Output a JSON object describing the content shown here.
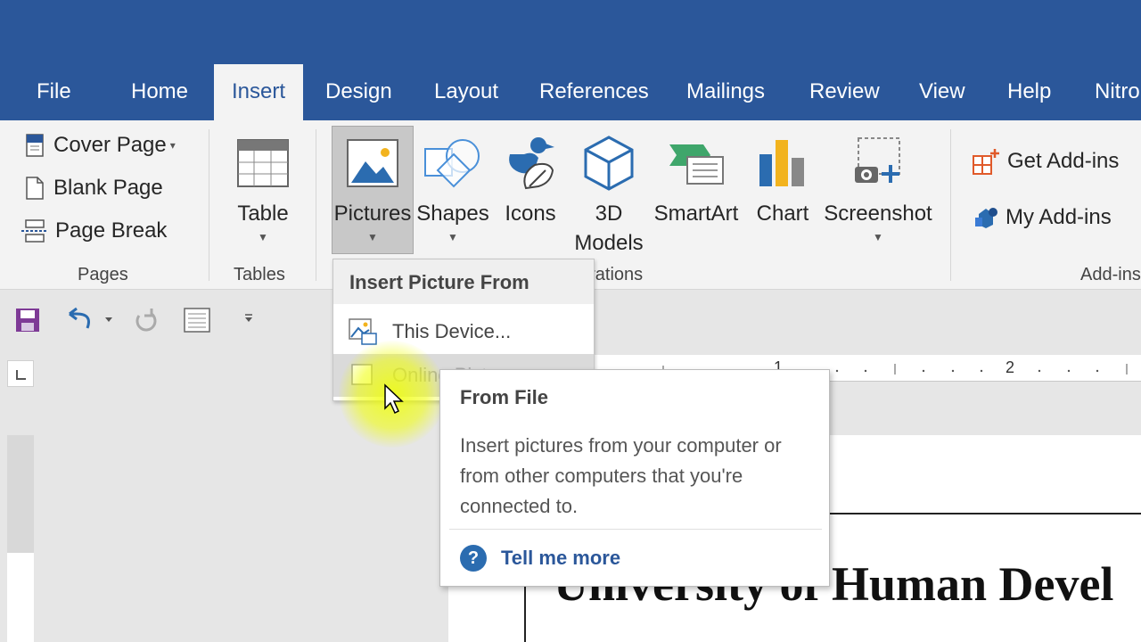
{
  "tabs": [
    "File",
    "Home",
    "Insert",
    "Design",
    "Layout",
    "References",
    "Mailings",
    "Review",
    "View",
    "Help",
    "Nitro"
  ],
  "active_tab": "Insert",
  "pages_group": {
    "label": "Pages",
    "items": [
      "Cover Page",
      "Blank Page",
      "Page Break"
    ]
  },
  "tables_group": {
    "label": "Tables",
    "table": "Table"
  },
  "illustrations_group": {
    "label": "Illustrations",
    "pictures": "Pictures",
    "shapes": "Shapes",
    "icons": "Icons",
    "models_line1": "3D",
    "models_line2": "Models",
    "smartart": "SmartArt",
    "chart": "Chart",
    "screenshot": "Screenshot"
  },
  "addins_group": {
    "label": "Add-ins",
    "get": "Get Add-ins",
    "my": "My Add-ins"
  },
  "dropdown": {
    "header": "Insert Picture From",
    "items": [
      "This Device...",
      "Online Pictures..."
    ]
  },
  "tooltip": {
    "title": "From File",
    "body": "Insert pictures from your computer or from other computers that you're connected to.",
    "link": "Tell me more"
  },
  "ruler": {
    "labels": [
      "1",
      "2"
    ]
  },
  "document": {
    "title": "University of Human Devel"
  },
  "colors": {
    "ribbon_blue": "#2b579a",
    "ribbon_bg": "#f3f3f3",
    "link": "#2b579a"
  }
}
